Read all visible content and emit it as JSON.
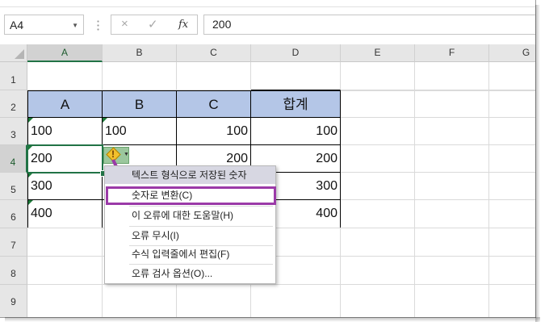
{
  "name_box": {
    "value": "A4"
  },
  "formula_bar": {
    "cancel_icon": "×",
    "enter_icon": "✓",
    "fx_label": "fx",
    "value": "200"
  },
  "columns": [
    "A",
    "B",
    "C",
    "D",
    "E",
    "F",
    "G"
  ],
  "rows": [
    "1",
    "2",
    "3",
    "4",
    "5",
    "6",
    "7",
    "8",
    "9"
  ],
  "table": {
    "headers": [
      "A",
      "B",
      "C",
      "합계"
    ],
    "rows": [
      [
        "100",
        "100",
        "100",
        "100"
      ],
      [
        "200",
        "",
        "200",
        "200"
      ],
      [
        "300",
        "",
        "",
        "300"
      ],
      [
        "400",
        "",
        "",
        "400"
      ]
    ]
  },
  "context_menu": {
    "title": "텍스트 형식으로 저장된 숫자",
    "items": [
      "숫자로 변환(C)",
      "이 오류에 대한 도움말(H)",
      "오류 무시(I)",
      "수식 입력줄에서 편집(F)",
      "오류 검사 옵션(O)..."
    ]
  },
  "colors": {
    "header_fill": "#b4c6e7",
    "accent": "#217346",
    "highlight": "#9b3aa8"
  }
}
